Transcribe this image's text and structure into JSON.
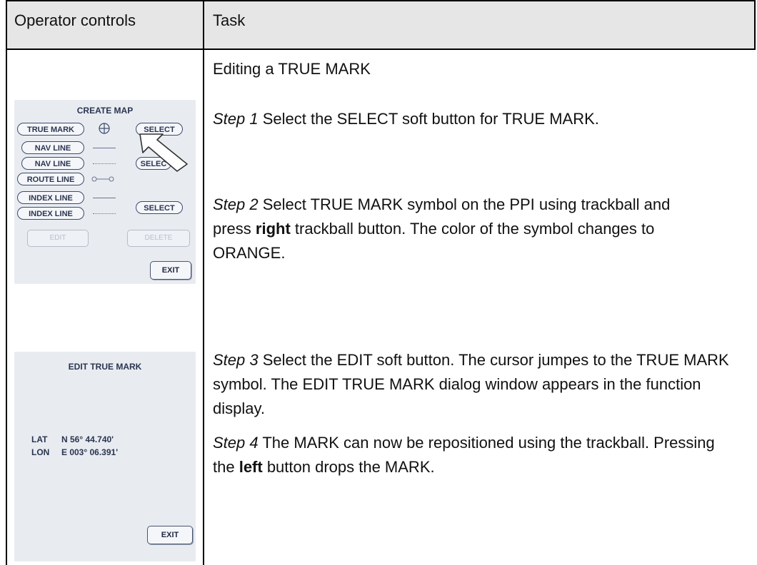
{
  "header": {
    "col1": "Operator controls",
    "col2": "Task"
  },
  "task": {
    "title": "Editing a TRUE MARK",
    "step1_label": "Step 1",
    "step1_text": " Select the SELECT soft button for TRUE MARK.",
    "step2_label": "Step 2",
    "step2_text_a": " Select TRUE MARK symbol on the PPI using trackball and   press ",
    "step2_bold": "right",
    "step2_text_b": " trackball button. The color of the symbol changes to ORANGE.",
    "step3_label": "Step 3",
    "step3_text": " Select the EDIT soft button. The cursor jumpes to the TRUE MARK symbol. The EDIT TRUE MARK dialog window appears in the function display.",
    "step4_label": "Step 4",
    "step4_text_a": " The MARK can now be repositioned using the trackball. Pressing the ",
    "step4_bold": "left",
    "step4_text_b": " button drops the MARK."
  },
  "create_map": {
    "title": "CREATE MAP",
    "buttons": {
      "true_mark": "TRUE MARK",
      "nav_line_1": "NAV LINE",
      "nav_line_2": "NAV LINE",
      "route_line": "ROUTE LINE",
      "index_line_1": "INDEX LINE",
      "index_line_2": "INDEX LINE",
      "select_1": "SELECT",
      "select_2": "SELEC",
      "select_3": "SELECT",
      "edit": "EDIT",
      "delete": "DELETE",
      "exit": "EXIT"
    }
  },
  "edit_true_mark": {
    "title": "EDIT TRUE MARK",
    "lat_label": "LAT",
    "lat_value": "N 56° 44.740'",
    "lon_label": "LON",
    "lon_value": "E 003° 06.391'",
    "exit": "EXIT"
  },
  "colors": {
    "header_bg": "#e6e6e6",
    "panel_bg": "#e8ecf1",
    "button_text": "#2a3550"
  }
}
